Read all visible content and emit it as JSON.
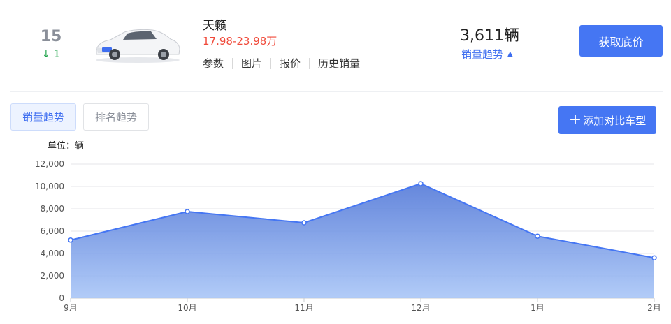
{
  "rank": {
    "number": "15",
    "change_arrow": "↓",
    "change_value": "1"
  },
  "car": {
    "name": "天籁",
    "price_range": "17.98-23.98万",
    "image_icon": "car-icon"
  },
  "links": [
    "参数",
    "图片",
    "报价",
    "历史销量"
  ],
  "sales": {
    "count": "3,611辆",
    "trend_label": "销量趋势",
    "trend_arrow": "▲"
  },
  "buttons": {
    "get_price": "获取底价",
    "add_compare": "添加对比车型",
    "add_icon": "+"
  },
  "tabs": [
    {
      "label": "销量趋势",
      "active": true
    },
    {
      "label": "排名趋势",
      "active": false
    }
  ],
  "colors": {
    "accent": "#4576f3",
    "price": "#f04a3a",
    "rank_down": "#1fa34a"
  },
  "chart_data": {
    "type": "area",
    "unit_label": "单位：辆",
    "categories": [
      "9月",
      "10月",
      "11月",
      "12月",
      "1月",
      "2月"
    ],
    "values": [
      5200,
      7750,
      6750,
      10250,
      5550,
      3611
    ],
    "ylim": [
      0,
      12000
    ],
    "yticks": [
      "0",
      "2,000",
      "4,000",
      "6,000",
      "8,000",
      "10,000",
      "12,000"
    ],
    "grid": true,
    "color": "#4576f3"
  }
}
